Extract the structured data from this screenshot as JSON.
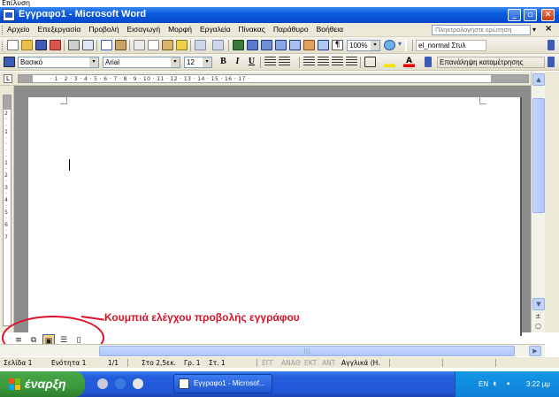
{
  "header": {
    "text": "Επίλυση"
  },
  "window": {
    "title": "Εγγραφο1 - Microsoft Word"
  },
  "menu": {
    "items": [
      "Αρχείο",
      "Επεξεργασία",
      "Προβολή",
      "Εισαγωγή",
      "Μορφή",
      "Εργαλεία",
      "Πίνακας",
      "Παράθυρο",
      "Βοήθεια"
    ],
    "help_placeholder": "Πληκτρολογήστε ερώτηση",
    "close_doc": "×"
  },
  "standard_toolbar": {
    "zoom": "100%",
    "style_box": "el_normal Στυλ"
  },
  "formatting_toolbar": {
    "style": "Βασικό",
    "font": "Arial",
    "size": "12",
    "bold": "B",
    "italic": "I",
    "underline": "U",
    "reply_with_changes": "Επανάληψη καταμέτρησης"
  },
  "ruler": {
    "numbers": "· 1 · 2 · 3 · 4 · 5 · 6 · 7 · 8 · 9 · 10 · 11 · 12 · 13 · 14 · 15 · 16 · 17 ·"
  },
  "annotation": {
    "text": "Κουμπιά ελέγχου προβολής εγγράφου"
  },
  "status": {
    "page": "Σελίδα 1",
    "section": "Ενότητα 1",
    "pages": "1/1",
    "position": "Στο 2,5εκ.",
    "line": "Γρ. 1",
    "column": "Στ. 1",
    "rec": "ΕΓΓ",
    "trk": "ΑΝΑΘ",
    "ext": "ΕΚΤ",
    "ovr": "ΑΝΤ",
    "language": "Αγγλικά (Η."
  },
  "taskbar": {
    "start": "έναρξη",
    "task_item": "Εγγραφο1 - Microsof...",
    "lang": "EN",
    "clock": "3:22 μμ"
  },
  "colors": {
    "title_blue": "#0a5ce0",
    "annotation_red": "#d2142a",
    "start_green": "#3a9a3a"
  }
}
